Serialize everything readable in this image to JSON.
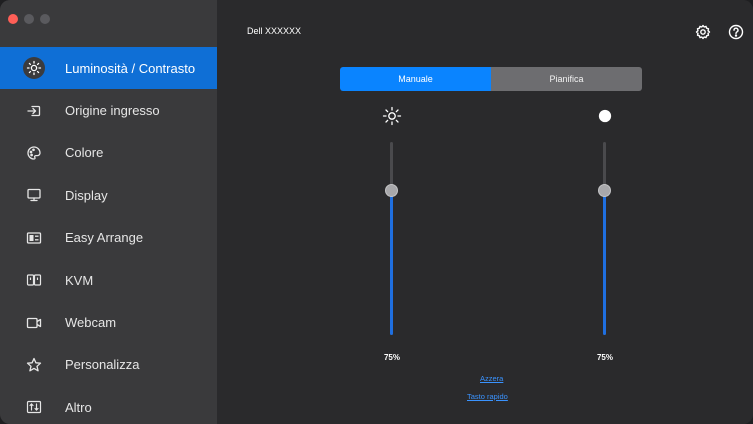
{
  "window": {
    "title": "Dell XXXXXX"
  },
  "sidebar": {
    "items": [
      {
        "label": "Luminosità / Contrasto",
        "icon": "brightness-icon",
        "active": true
      },
      {
        "label": "Origine ingresso",
        "icon": "input-source-icon",
        "active": false
      },
      {
        "label": "Colore",
        "icon": "color-palette-icon",
        "active": false
      },
      {
        "label": "Display",
        "icon": "monitor-icon",
        "active": false
      },
      {
        "label": "Easy Arrange",
        "icon": "easy-arrange-icon",
        "active": false
      },
      {
        "label": "KVM",
        "icon": "kvm-icon",
        "active": false
      },
      {
        "label": "Webcam",
        "icon": "webcam-icon",
        "active": false
      },
      {
        "label": "Personalizza",
        "icon": "star-icon",
        "active": false
      },
      {
        "label": "Altro",
        "icon": "more-settings-icon",
        "active": false
      }
    ]
  },
  "toolbar": {
    "settings_icon": "gear-icon",
    "help_icon": "help-icon"
  },
  "mode_tabs": [
    {
      "label": "Manuale",
      "selected": true
    },
    {
      "label": "Pianifica",
      "selected": false
    }
  ],
  "sliders": {
    "brightness": {
      "icon": "sun-icon",
      "value": 75,
      "value_label": "75%"
    },
    "contrast": {
      "icon": "contrast-icon",
      "value": 75,
      "value_label": "75%"
    }
  },
  "links": {
    "reset": "Azzera",
    "hotkey": "Tasto rapido"
  },
  "colors": {
    "accent": "#0a84ff",
    "sidebar_active": "#0f6fd6",
    "sidebar_bg": "#3a3a3c",
    "main_bg": "#2a2a2c"
  }
}
